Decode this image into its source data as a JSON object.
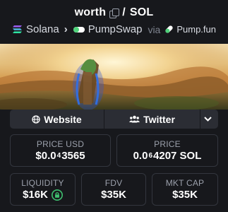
{
  "header": {
    "token_name": "worth",
    "separator": "/",
    "quote": "SOL",
    "chain": "Solana",
    "dex": "PumpSwap",
    "via": "via",
    "launchpad": "Pump.fun"
  },
  "banner": {
    "icon": "token-banner-image"
  },
  "links": {
    "website_label": "Website",
    "twitter_label": "Twitter"
  },
  "stats": {
    "price_usd": {
      "label": "PRICE USD",
      "prefix": "$0.0",
      "zeros": "4",
      "digits": "3565"
    },
    "price_sol": {
      "label": "PRICE",
      "prefix": "0.0",
      "zeros": "6",
      "digits": "4207 SOL"
    },
    "liquidity": {
      "label": "LIQUIDITY",
      "value": "$16K"
    },
    "fdv": {
      "label": "FDV",
      "value": "$35K"
    },
    "mkt_cap": {
      "label": "MKT CAP",
      "value": "$35K"
    }
  },
  "colors": {
    "background": "#17181c",
    "card_border": "#33363e",
    "muted_text": "#9ba0ab",
    "lock_green": "#3fbf6f"
  }
}
